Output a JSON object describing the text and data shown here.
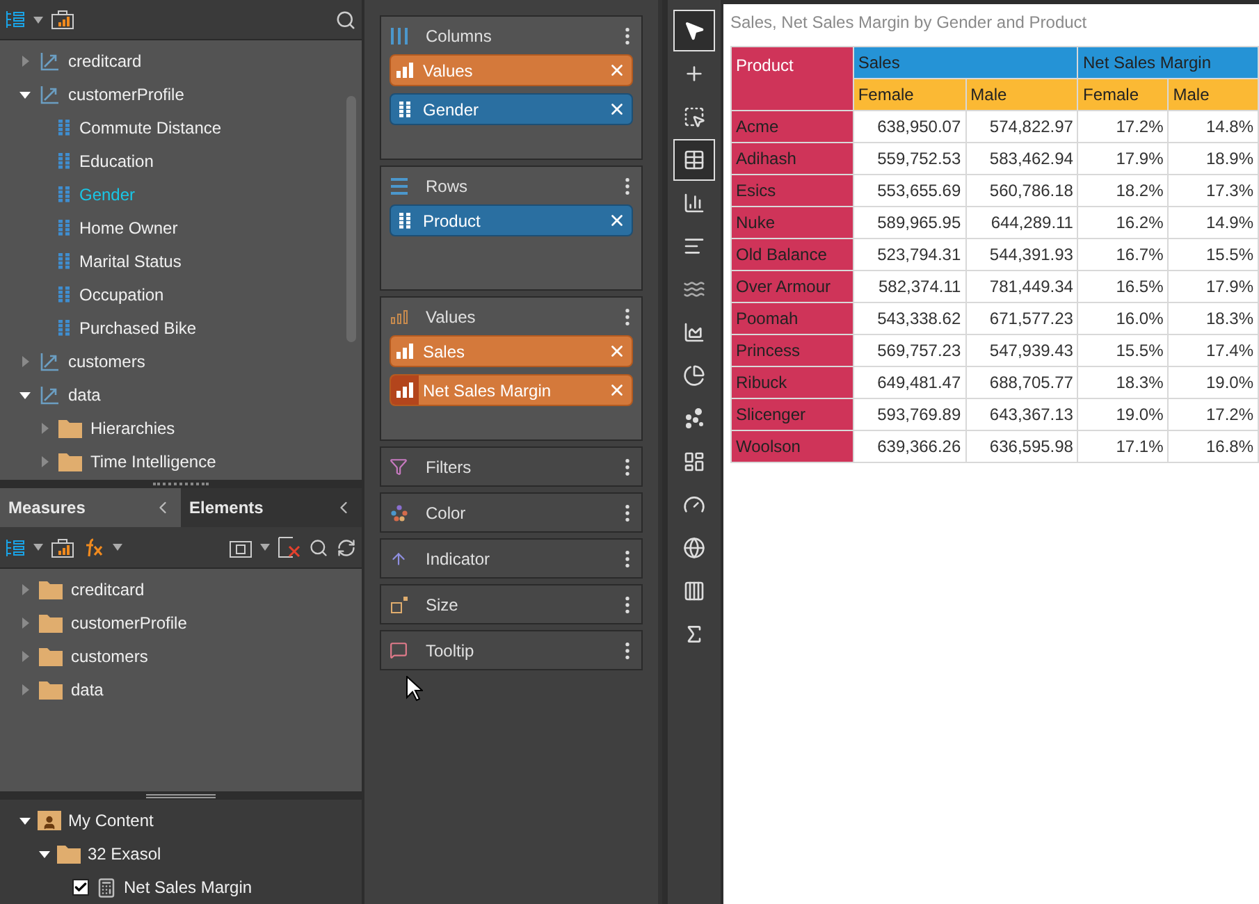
{
  "fields_tree": [
    {
      "label": "creditcard",
      "kind": "dimension",
      "expanded": false,
      "selected": false
    },
    {
      "label": "customerProfile",
      "kind": "dimension",
      "expanded": true,
      "selected": false,
      "children": [
        {
          "label": "Commute Distance",
          "kind": "level",
          "selected": false
        },
        {
          "label": "Education",
          "kind": "level",
          "selected": false
        },
        {
          "label": "Gender",
          "kind": "level",
          "selected": true
        },
        {
          "label": "Home Owner",
          "kind": "level",
          "selected": false
        },
        {
          "label": "Marital Status",
          "kind": "level",
          "selected": false
        },
        {
          "label": "Occupation",
          "kind": "level",
          "selected": false
        },
        {
          "label": "Purchased Bike",
          "kind": "level",
          "selected": false
        }
      ]
    },
    {
      "label": "customers",
      "kind": "dimension",
      "expanded": false,
      "selected": false
    },
    {
      "label": "data",
      "kind": "dimension",
      "expanded": true,
      "selected": false,
      "children": [
        {
          "label": "Hierarchies",
          "kind": "folder",
          "expanded": false,
          "selected": false
        },
        {
          "label": "Time Intelligence",
          "kind": "folder",
          "expanded": false,
          "selected": false
        }
      ]
    }
  ],
  "panel_tabs": [
    {
      "label": "Measures",
      "selected": true
    },
    {
      "label": "Elements",
      "selected": false
    }
  ],
  "measures_tree": [
    {
      "label": "creditcard",
      "expanded": false
    },
    {
      "label": "customerProfile",
      "expanded": false
    },
    {
      "label": "customers",
      "expanded": false
    },
    {
      "label": "data",
      "expanded": false
    }
  ],
  "content_tree": [
    {
      "label": "My Content",
      "kind": "user-folder",
      "expanded": true,
      "children": [
        {
          "label": "32 Exasol",
          "kind": "folder",
          "expanded": true,
          "children": [
            {
              "label": "Net Sales Margin",
              "kind": "calc",
              "checked": true
            }
          ]
        }
      ]
    }
  ],
  "drop_zones": [
    {
      "title": "Columns",
      "kind": "columns",
      "chips": [
        {
          "label": "Values",
          "kind": "measure",
          "selected": false
        },
        {
          "label": "Gender",
          "kind": "dimension",
          "selected": false
        }
      ]
    },
    {
      "title": "Rows",
      "kind": "rows",
      "chips": [
        {
          "label": "Product",
          "kind": "dimension",
          "selected": false
        }
      ]
    },
    {
      "title": "Values",
      "kind": "values",
      "chips": [
        {
          "label": "Sales",
          "kind": "measure",
          "selected": false
        },
        {
          "label": "Net Sales Margin",
          "kind": "measure",
          "selected": true
        }
      ]
    },
    {
      "title": "Filters",
      "kind": "filters"
    },
    {
      "title": "Color",
      "kind": "color"
    },
    {
      "title": "Indicator",
      "kind": "indicator"
    },
    {
      "title": "Size",
      "kind": "size"
    },
    {
      "title": "Tooltip",
      "kind": "tooltip"
    }
  ],
  "tools": [
    {
      "kind": "pointer",
      "selected": true
    },
    {
      "kind": "add",
      "selected": false
    },
    {
      "kind": "select-area",
      "selected": false
    },
    {
      "kind": "table",
      "selected": true
    },
    {
      "kind": "column-chart",
      "selected": false
    },
    {
      "kind": "bar-chart",
      "selected": false
    },
    {
      "kind": "line-chart",
      "selected": false
    },
    {
      "kind": "area-chart",
      "selected": false
    },
    {
      "kind": "pie-chart",
      "selected": false
    },
    {
      "kind": "scatter-chart",
      "selected": false
    },
    {
      "kind": "tree-map",
      "selected": false
    },
    {
      "kind": "gauge",
      "selected": false
    },
    {
      "kind": "map",
      "selected": false
    },
    {
      "kind": "grid",
      "selected": false
    },
    {
      "kind": "formula",
      "selected": false
    }
  ],
  "report": {
    "title": "Sales, Net Sales Margin by Gender and Product",
    "row_header": "Product",
    "groups": [
      "Sales",
      "Net Sales Margin"
    ],
    "subcolumns": [
      "Female",
      "Male",
      "Female",
      "Male"
    ],
    "rows": [
      [
        "Acme",
        "638,950.07",
        "574,822.97",
        "17.2%",
        "14.8%"
      ],
      [
        "Adihash",
        "559,752.53",
        "583,462.94",
        "17.9%",
        "18.9%"
      ],
      [
        "Esics",
        "553,655.69",
        "560,786.18",
        "18.2%",
        "17.3%"
      ],
      [
        "Nuke",
        "589,965.95",
        "644,289.11",
        "16.2%",
        "14.9%"
      ],
      [
        "Old Balance",
        "523,794.31",
        "544,391.93",
        "16.7%",
        "15.5%"
      ],
      [
        "Over Armour",
        "582,374.11",
        "781,449.34",
        "16.5%",
        "17.9%"
      ],
      [
        "Poomah",
        "543,338.62",
        "671,577.23",
        "16.0%",
        "18.3%"
      ],
      [
        "Princess",
        "569,757.23",
        "547,939.43",
        "15.5%",
        "17.4%"
      ],
      [
        "Ribuck",
        "649,481.47",
        "688,705.77",
        "18.3%",
        "19.0%"
      ],
      [
        "Slicenger",
        "593,769.89",
        "643,367.13",
        "19.0%",
        "17.2%"
      ],
      [
        "Woolson",
        "639,366.26",
        "636,595.98",
        "17.1%",
        "16.8%"
      ]
    ]
  }
}
